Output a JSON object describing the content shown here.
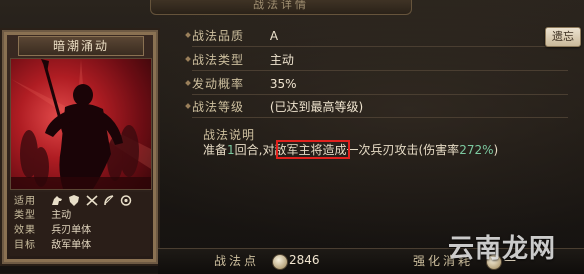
{
  "window": {
    "top_banner": "战法详情"
  },
  "card": {
    "title": "暗潮涌动",
    "stats": {
      "applicable_key": "适用",
      "troop_icons": [
        "cavalry-icon",
        "shield-icon",
        "spear-icon",
        "bow-icon",
        "catapult-icon"
      ],
      "type_key": "类型",
      "type_value": "主动",
      "effect_key": "效果",
      "effect_value": "兵刃单体",
      "target_key": "目标",
      "target_value": "敌军单体"
    }
  },
  "info": {
    "rows": [
      {
        "label": "战法品质",
        "value": "A"
      },
      {
        "label": "战法类型",
        "value": "主动"
      },
      {
        "label": "发动概率",
        "value": "35%"
      },
      {
        "label": "战法等级",
        "value": "(已达到最高等级)"
      }
    ],
    "level_button": "遗忘",
    "description_title": "战法说明",
    "description": {
      "part1": "准备",
      "num1": "1",
      "part2": "回合,",
      "highlight": "对敌军主将",
      "part3": "造成一次兵刃攻击(伤害率",
      "num2": "272%",
      "part4": ")"
    }
  },
  "bottom": {
    "points_label": "战法点",
    "points_value": "2846",
    "upgrade_label": "强化消耗",
    "upgrade_value": "—"
  },
  "watermark": "云南龙网",
  "colors": {
    "highlight_box": "#e0211d",
    "value_green": "#7cc9a0"
  }
}
